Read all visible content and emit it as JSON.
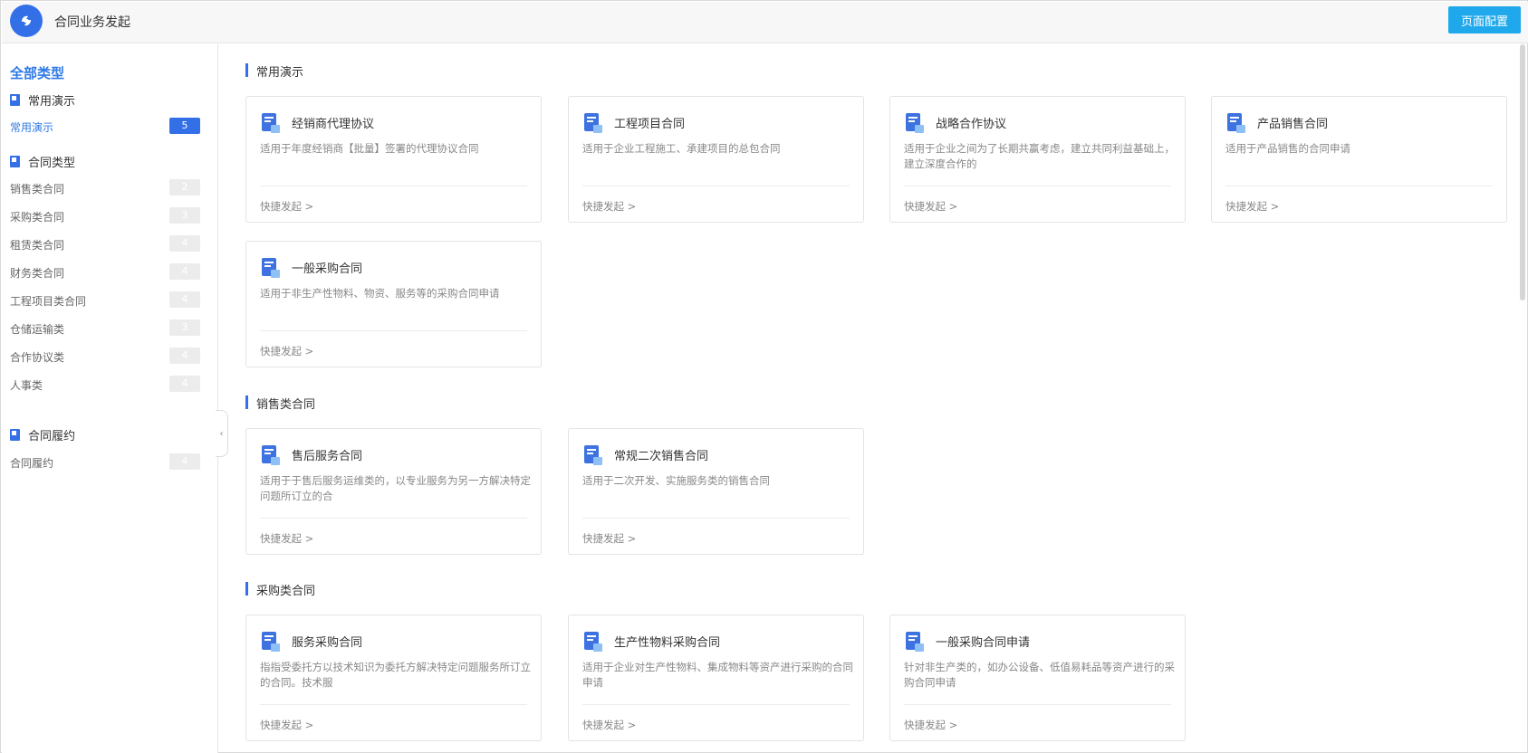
{
  "header": {
    "title": "合同业务发起",
    "config_button": "页面配置"
  },
  "sidebar": {
    "all_label": "全部类型",
    "groups": [
      {
        "label": "常用演示",
        "items": [
          {
            "label": "常用演示",
            "count": "5",
            "active": true
          }
        ]
      },
      {
        "label": "合同类型",
        "items": [
          {
            "label": "销售类合同",
            "count": "2"
          },
          {
            "label": "采购类合同",
            "count": "3"
          },
          {
            "label": "租赁类合同",
            "count": "4"
          },
          {
            "label": "财务类合同",
            "count": "4"
          },
          {
            "label": "工程项目类合同",
            "count": "4"
          },
          {
            "label": "仓储运输类",
            "count": "3"
          },
          {
            "label": "合作协议类",
            "count": "4"
          },
          {
            "label": "人事类",
            "count": "4"
          }
        ]
      },
      {
        "label": "合同履约",
        "items": [
          {
            "label": "合同履约",
            "count": "4"
          }
        ]
      }
    ]
  },
  "sections": [
    {
      "title": "常用演示",
      "cards": [
        {
          "title": "经销商代理协议",
          "desc": "适用于年度经销商【批量】签署的代理协议合同",
          "link": "快捷发起 >"
        },
        {
          "title": "工程项目合同",
          "desc": "适用于企业工程施工、承建项目的总包合同",
          "link": "快捷发起 >"
        },
        {
          "title": "战略合作协议",
          "desc": "适用于企业之间为了长期共赢考虑，建立共同利益基础上，建立深度合作的",
          "link": "快捷发起 >"
        },
        {
          "title": "产品销售合同",
          "desc": "适用于产品销售的合同申请",
          "link": "快捷发起 >"
        },
        {
          "title": "一般采购合同",
          "desc": "适用于非生产性物料、物资、服务等的采购合同申请",
          "link": "快捷发起 >"
        }
      ]
    },
    {
      "title": "销售类合同",
      "cards": [
        {
          "title": "售后服务合同",
          "desc": "适用于于售后服务运维类的，以专业服务为另一方解决特定问题所订立的合",
          "link": "快捷发起 >"
        },
        {
          "title": "常规二次销售合同",
          "desc": "适用于二次开发、实施服务类的销售合同",
          "link": "快捷发起 >"
        }
      ]
    },
    {
      "title": "采购类合同",
      "cards": [
        {
          "title": "服务采购合同",
          "desc": "指指受委托方以技术知识为委托方解决特定问题服务所订立的合同。技术服",
          "link": "快捷发起 >"
        },
        {
          "title": "生产性物料采购合同",
          "desc": "适用于企业对生产性物料、集成物料等资产进行采购的合同申请",
          "link": "快捷发起 >"
        },
        {
          "title": "一般采购合同申请",
          "desc": "针对非生产类的，如办公设备、低值易耗品等资产进行的采购合同申请",
          "link": "快捷发起 >"
        }
      ]
    }
  ],
  "colors": {
    "accent": "#3370e8",
    "button": "#1fa9ec",
    "link_active": "#2f7ae5"
  },
  "icons": {
    "logo": "app-logo-icon",
    "group": "bookmark-icon",
    "card": "document-icon",
    "collapse": "chevron-left-icon"
  }
}
